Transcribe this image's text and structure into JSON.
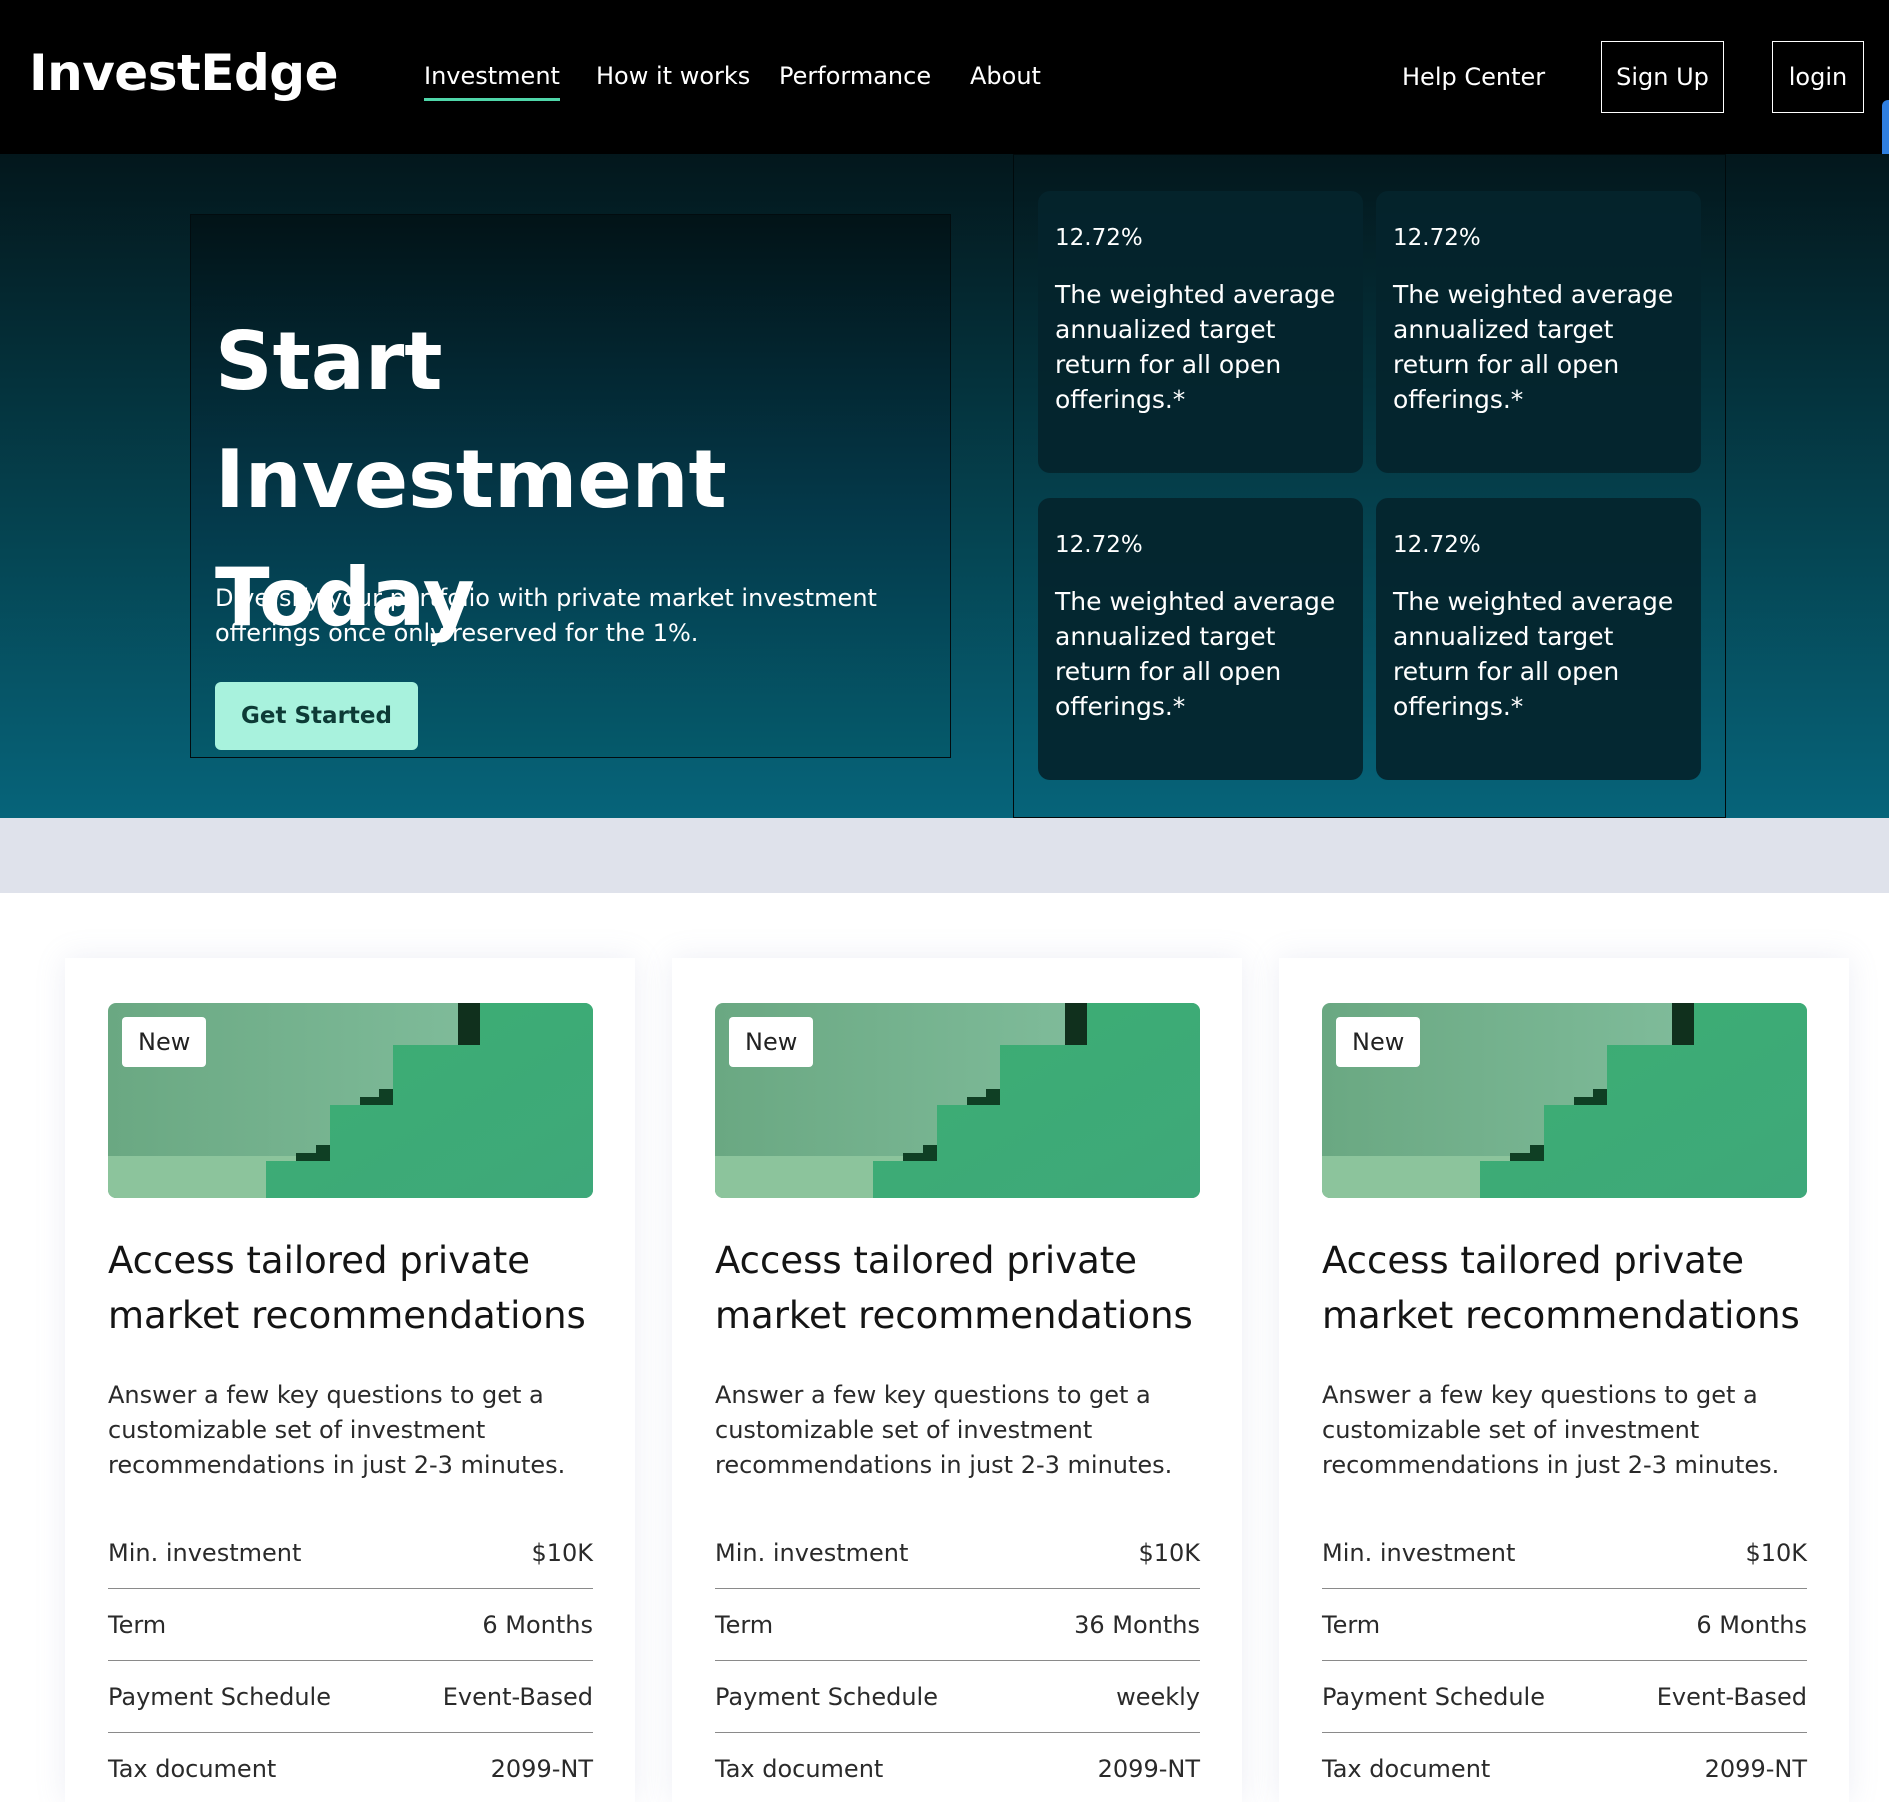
{
  "header": {
    "logo": "InvestEdge",
    "nav": [
      "Investment",
      "How it works",
      "Performance",
      "About"
    ],
    "help": "Help Center",
    "signup": "Sign Up",
    "login": "login"
  },
  "hero": {
    "title": "Start Investment Today",
    "description": "Diversify your portfolio with private market investment offerings once only reserved for the 1%.",
    "cta": "Get Started"
  },
  "stats": [
    {
      "value": "12.72%",
      "text": "The weighted average annualized target return for all open offerings.*"
    },
    {
      "value": "12.72%",
      "text": "The weighted average annualized target return for all open offerings.*"
    },
    {
      "value": "12.72%",
      "text": "The weighted average annualized target return for all open offerings.*"
    },
    {
      "value": "12.72%",
      "text": "The weighted average annualized target return for all open offerings.*"
    }
  ],
  "offerings": [
    {
      "badge": "New",
      "title": "Access tailored private market recommendations",
      "description": "Answer a few key questions to get a customizable set of investment recommendations in just 2-3 minutes.",
      "rows": [
        {
          "label": "Min. investment",
          "value": "$10K"
        },
        {
          "label": "Term",
          "value": "6 Months"
        },
        {
          "label": "Payment Schedule",
          "value": "Event-Based"
        },
        {
          "label": "Tax document",
          "value": "2099-NT"
        }
      ]
    },
    {
      "badge": "New",
      "title": "Access tailored private market recommendations",
      "description": "Answer a few key questions to get a customizable set of investment recommendations in just 2-3 minutes.",
      "rows": [
        {
          "label": "Min. investment",
          "value": "$10K"
        },
        {
          "label": "Term",
          "value": "36 Months"
        },
        {
          "label": "Payment Schedule",
          "value": "weekly"
        },
        {
          "label": "Tax document",
          "value": "2099-NT"
        }
      ]
    },
    {
      "badge": "New",
      "title": "Access tailored private market recommendations",
      "description": "Answer a few key questions to get a customizable set of investment recommendations in just 2-3 minutes.",
      "rows": [
        {
          "label": "Min. investment",
          "value": "$10K"
        },
        {
          "label": "Term",
          "value": "6 Months"
        },
        {
          "label": "Payment Schedule",
          "value": "Event-Based"
        },
        {
          "label": "Tax document",
          "value": "2099-NT"
        }
      ]
    }
  ],
  "colors": {
    "header_bg": "#000000",
    "accent_underline": "#4fd6a9",
    "cta_bg": "#a8f2dd",
    "hero_top": "#03171c",
    "hero_bottom": "#06647a",
    "band": "#dfe2eb",
    "stairs_green": "#3aa872"
  }
}
